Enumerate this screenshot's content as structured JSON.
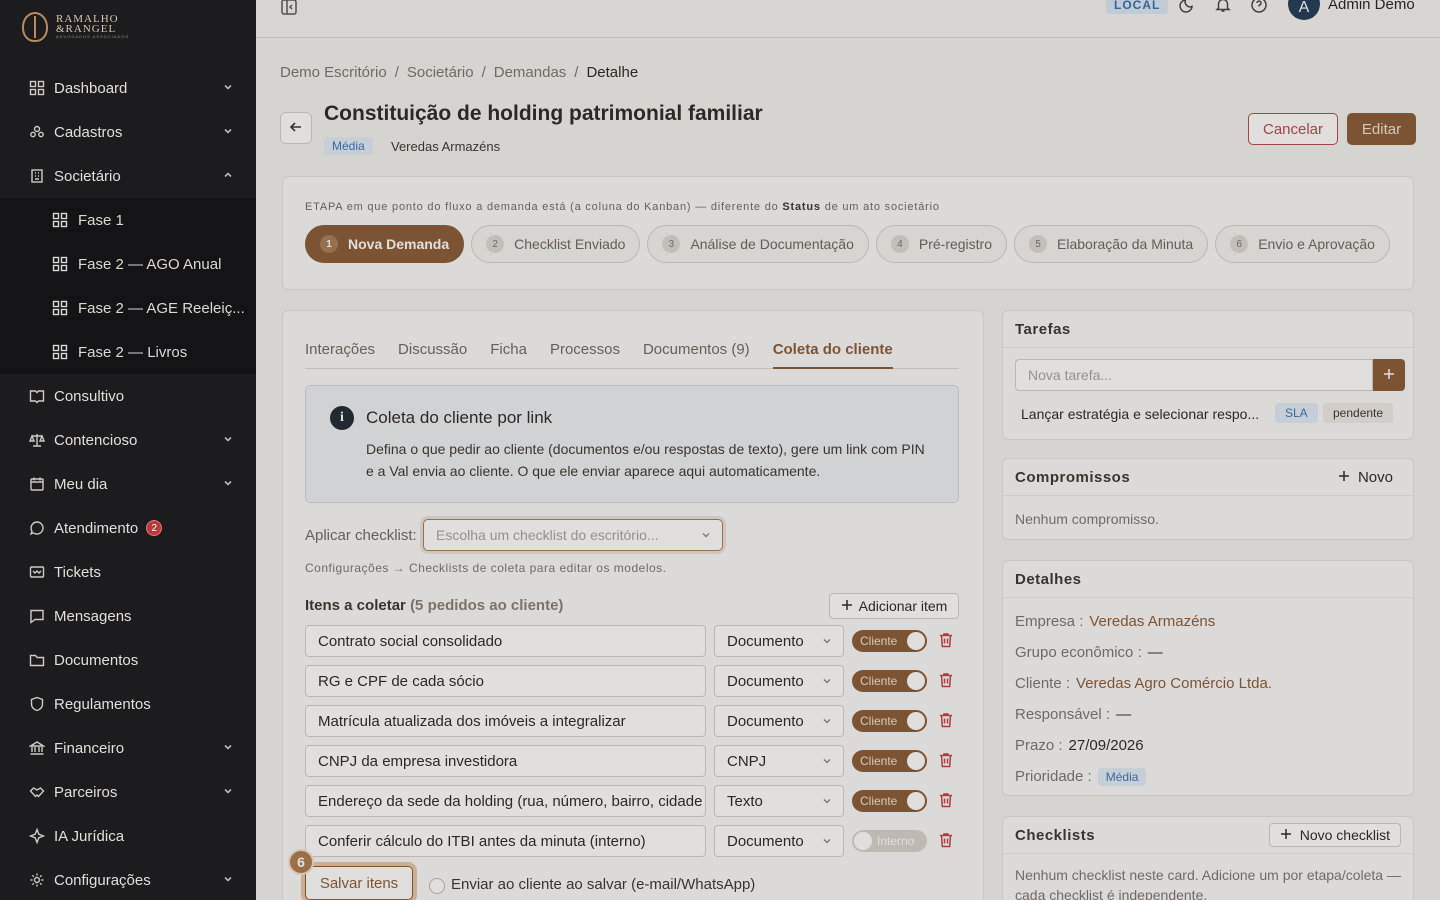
{
  "sidebar": {
    "logo": {
      "line1": "RAMALHO",
      "line2": "&RANGEL",
      "sub": "ADVOGADOS ASSOCIADOS"
    },
    "items": [
      {
        "label": "Dashboard",
        "icon": "grid-icon",
        "chevron": "down"
      },
      {
        "label": "Cadastros",
        "icon": "users-icon",
        "chevron": "down"
      },
      {
        "label": "Societário",
        "icon": "building-icon",
        "chevron": "up"
      }
    ],
    "subitems": [
      {
        "label": "Fase 1"
      },
      {
        "label": "Fase 2 — AGO Anual"
      },
      {
        "label": "Fase 2 — AGE Reeleiç..."
      },
      {
        "label": "Fase 2 — Livros"
      }
    ],
    "items2": [
      {
        "label": "Consultivo",
        "icon": "book-icon",
        "chevron": ""
      },
      {
        "label": "Contencioso",
        "icon": "scales-icon",
        "chevron": "down"
      },
      {
        "label": "Meu dia",
        "icon": "calendar-icon",
        "chevron": "down"
      },
      {
        "label": "Atendimento",
        "icon": "chat-icon",
        "chevron": "",
        "badge": "2"
      },
      {
        "label": "Tickets",
        "icon": "ticket-icon",
        "chevron": ""
      },
      {
        "label": "Mensagens",
        "icon": "message-icon",
        "chevron": ""
      },
      {
        "label": "Documentos",
        "icon": "folder-icon",
        "chevron": ""
      },
      {
        "label": "Regulamentos",
        "icon": "shield-icon",
        "chevron": ""
      },
      {
        "label": "Financeiro",
        "icon": "bank-icon",
        "chevron": "down"
      },
      {
        "label": "Parceiros",
        "icon": "handshake-icon",
        "chevron": "down"
      },
      {
        "label": "IA Jurídica",
        "icon": "sparkle-icon",
        "chevron": ""
      },
      {
        "label": "Configurações",
        "icon": "gear-icon",
        "chevron": "down"
      }
    ]
  },
  "topbar": {
    "env_badge": "LOCAL",
    "avatar_letter": "A",
    "user_name": "Admin Demo"
  },
  "breadcrumb": [
    "Demo Escritório",
    "Societário",
    "Demandas",
    "Detalhe"
  ],
  "header": {
    "title": "Constituição de holding patrimonial familiar",
    "priority": "Média",
    "company": "Veredas Armazéns",
    "cancel_label": "Cancelar",
    "edit_label": "Editar"
  },
  "stage": {
    "note_prefix": "ETAPA",
    "note_mid": "em que ponto do fluxo a demanda está (a coluna do Kanban) — diferente do",
    "note_bold": "Status",
    "note_suffix": "de um ato societário",
    "steps": [
      {
        "num": "1",
        "label": "Nova Demanda",
        "active": true
      },
      {
        "num": "2",
        "label": "Checklist Enviado"
      },
      {
        "num": "3",
        "label": "Análise de Documentação"
      },
      {
        "num": "4",
        "label": "Pré-registro"
      },
      {
        "num": "5",
        "label": "Elaboração da Minuta"
      },
      {
        "num": "6",
        "label": "Envio e Aprovação"
      }
    ]
  },
  "tabs": [
    "Interações",
    "Discussão",
    "Ficha",
    "Processos",
    "Documentos (9)",
    "Coleta do cliente"
  ],
  "coleta": {
    "info_title": "Coleta do cliente por link",
    "info_text": "Defina o que pedir ao cliente (documentos e/ou respostas de texto), gere um link com PIN e a Val envia ao cliente. O que ele enviar aparece aqui automaticamente.",
    "apply_label": "Aplicar checklist:",
    "apply_placeholder": "Escolha um checklist do escritório...",
    "config_hint": "Configurações → Checklists de coleta para editar os modelos.",
    "items_title": "Itens a coletar",
    "items_count": "(5 pedidos ao cliente)",
    "add_item_label": "Adicionar item",
    "items": [
      {
        "text": "Contrato social consolidado",
        "type": "Documento",
        "toggle": "Cliente",
        "on": true
      },
      {
        "text": "RG e CPF de cada sócio",
        "type": "Documento",
        "toggle": "Cliente",
        "on": true
      },
      {
        "text": "Matrícula atualizada dos imóveis a integralizar",
        "type": "Documento",
        "toggle": "Cliente",
        "on": true
      },
      {
        "text": "CNPJ da empresa investidora",
        "type": "CNPJ",
        "toggle": "Cliente",
        "on": true
      },
      {
        "text": "Endereço da sede da holding (rua, número, bairro, cidade",
        "type": "Texto",
        "toggle": "Cliente",
        "on": true
      },
      {
        "text": "Conferir cálculo do ITBI antes da minuta (interno)",
        "type": "Documento",
        "toggle": "Interno",
        "on": false
      }
    ],
    "step_badge": "6",
    "save_label": "Salvar itens",
    "send_label": "Enviar ao cliente ao salvar (e-mail/WhatsApp)"
  },
  "tarefas": {
    "title": "Tarefas",
    "placeholder": "Nova tarefa...",
    "task_text": "Lançar estratégia e selecionar respo...",
    "sla": "SLA",
    "status": "pendente"
  },
  "compromissos": {
    "title": "Compromissos",
    "new_label": "Novo",
    "empty": "Nenhum compromisso."
  },
  "detalhes": {
    "title": "Detalhes",
    "rows": [
      {
        "label": "Empresa :",
        "value": "Veredas Armazéns",
        "link": true
      },
      {
        "label": "Grupo econômico :",
        "value": "—"
      },
      {
        "label": "Cliente :",
        "value": "Veredas Agro Comércio Ltda.",
        "link": true
      },
      {
        "label": "Responsável :",
        "value": "—"
      },
      {
        "label": "Prazo :",
        "value": "27/09/2026"
      },
      {
        "label": "Prioridade :",
        "value": "Média",
        "badge": true
      }
    ]
  },
  "checklists": {
    "title": "Checklists",
    "new_label": "Novo checklist",
    "empty": "Nenhum checklist neste card. Adicione um por etapa/coleta — cada checklist é independente."
  },
  "colors": {
    "brand": "#8a5a34",
    "sidebar_bg": "#1c1b1d",
    "danger": "#b54848",
    "info": "#3b74b3"
  }
}
